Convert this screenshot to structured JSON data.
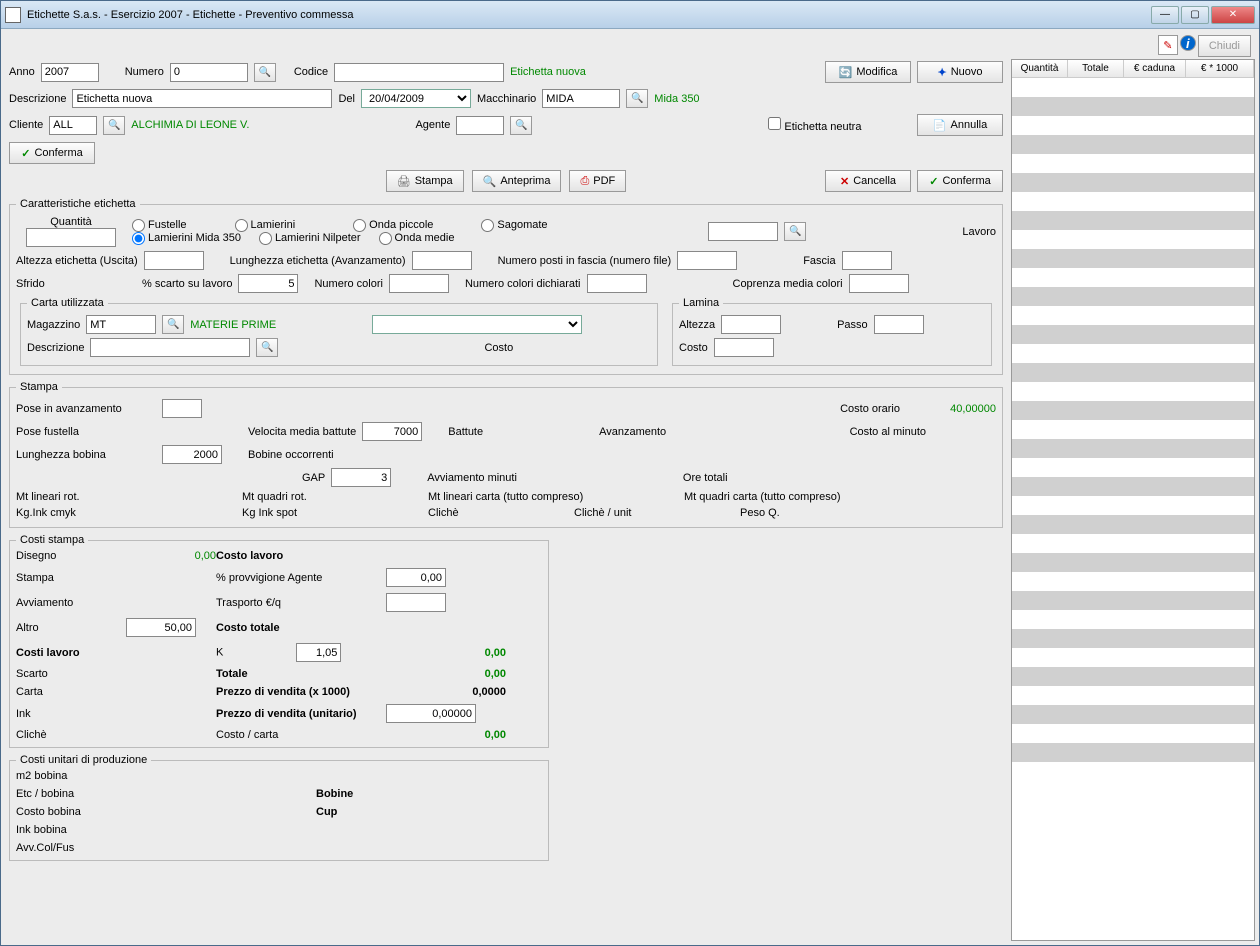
{
  "window": {
    "title": "Etichette S.a.s. - Esercizio 2007 - Etichette - Preventivo commessa"
  },
  "toolbar": {
    "chiudi": "Chiudi",
    "modifica": "Modifica",
    "nuovo": "Nuovo",
    "annulla": "Annulla",
    "conferma": "Conferma",
    "cancella": "Cancella",
    "stampa": "Stampa",
    "anteprima": "Anteprima",
    "pdf": "PDF"
  },
  "head": {
    "anno_lbl": "Anno",
    "anno": "2007",
    "numero_lbl": "Numero",
    "numero": "0",
    "codice_lbl": "Codice",
    "codice": "",
    "etichetta_nuova": "Etichetta nuova",
    "descrizione_lbl": "Descrizione",
    "descrizione": "Etichetta nuova",
    "del_lbl": "Del",
    "del": "20/04/2009",
    "macchinario_lbl": "Macchinario",
    "macchinario": "MIDA",
    "macchinario_desc": "Mida 350",
    "cliente_lbl": "Cliente",
    "cliente": "ALL",
    "cliente_desc": "ALCHIMIA DI LEONE V.",
    "agente_lbl": "Agente",
    "agente": "",
    "etichetta_neutra_lbl": "Etichetta neutra"
  },
  "grid": {
    "h1": "Quantità",
    "h2": "Totale",
    "h3": "€ caduna",
    "h4": "€ * 1000"
  },
  "caratt": {
    "legend": "Caratteristiche etichetta",
    "quantita_lbl": "Quantità",
    "quantita": "",
    "r_fustelle": "Fustelle",
    "r_lamierini": "Lamierini",
    "r_onda_piccole": "Onda piccole",
    "r_sagomate": "Sagomate",
    "r_lamierini_mida": "Lamierini Mida 350",
    "r_lamierini_nilpeter": "Lamierini Nilpeter",
    "r_onda_medie": "Onda medie",
    "lavoro_lbl": "Lavoro",
    "lavoro": "",
    "altezza_lbl": "Altezza etichetta (Uscita)",
    "altezza": "",
    "lunghezza_lbl": "Lunghezza etichetta (Avanzamento)",
    "lunghezza": "",
    "posti_lbl": "Numero posti in fascia (numero file)",
    "posti": "",
    "fascia_lbl": "Fascia",
    "fascia": "",
    "sfrido_lbl": "Sfrido",
    "scarto_lbl": "% scarto su lavoro",
    "scarto": "5",
    "ncolori_lbl": "Numero colori",
    "ncolori": "",
    "ncolori_dich_lbl": "Numero colori dichiarati",
    "ncolori_dich": "",
    "coprenza_lbl": "Coprenza media colori",
    "coprenza": ""
  },
  "carta": {
    "legend": "Carta utilizzata",
    "magazzino_lbl": "Magazzino",
    "magazzino": "MT",
    "magazzino_desc": "MATERIE PRIME",
    "combo": "",
    "descrizione_lbl": "Descrizione",
    "descrizione": "",
    "costo_lbl": "Costo"
  },
  "lamina": {
    "legend": "Lamina",
    "altezza_lbl": "Altezza",
    "altezza": "",
    "passo_lbl": "Passo",
    "passo": "",
    "costo_lbl": "Costo",
    "costo": ""
  },
  "stampa": {
    "legend": "Stampa",
    "pose_avz_lbl": "Pose in avanzamento",
    "pose_avz": "",
    "costo_orario_lbl": "Costo orario",
    "costo_orario": "40,00000",
    "pose_fust_lbl": "Pose fustella",
    "pose_fust": "",
    "vel_lbl": "Velocita media battute",
    "vel": "7000",
    "battute_lbl": "Battute",
    "avanzamento_lbl": "Avanzamento",
    "costo_min_lbl": "Costo al minuto",
    "lungh_bob_lbl": "Lunghezza bobina",
    "lungh_bob": "2000",
    "bobine_occ_lbl": "Bobine occorrenti",
    "gap_lbl": "GAP",
    "gap": "3",
    "avv_min_lbl": "Avviamento minuti",
    "ore_tot_lbl": "Ore totali",
    "mt_lin_rot_lbl": "Mt lineari rot.",
    "mt_quad_rot_lbl": "Mt quadri rot.",
    "mt_lin_carta_lbl": "Mt lineari carta (tutto compreso)",
    "mt_quad_carta_lbl": "Mt quadri carta (tutto compreso)",
    "kg_ink_cmyk_lbl": "Kg.Ink cmyk",
    "kg_ink_spot_lbl": "Kg Ink spot",
    "cliche_lbl": "Clichè",
    "cliche_unit_lbl": "Clichè / unit",
    "peso_q_lbl": "Peso Q."
  },
  "costi": {
    "legend": "Costi stampa",
    "disegno_lbl": "Disegno",
    "disegno": "0,00",
    "stampa_lbl": "Stampa",
    "avviamento_lbl": "Avviamento",
    "altro_lbl": "Altro",
    "altro": "50,00",
    "costi_lavoro_lbl": "Costi lavoro",
    "scarto_lbl": "Scarto",
    "carta_lbl": "Carta",
    "ink_lbl": "Ink",
    "cliche_lbl": "Clichè",
    "costo_lavoro_lbl": "Costo lavoro",
    "provv_lbl": "%  provvigione Agente",
    "provv": "0,00",
    "trasporto_lbl": "Trasporto €/q",
    "trasporto": "",
    "costo_tot_lbl": "Costo totale",
    "k_lbl": "K",
    "k": "1,05",
    "k_val": "0,00",
    "totale_lbl": "Totale",
    "totale": "0,00",
    "prezzo_x1000_lbl": "Prezzo di vendita (x 1000)",
    "prezzo_x1000": "0,0000",
    "prezzo_unit_lbl": "Prezzo di vendita (unitario)",
    "prezzo_unit": "0,00000",
    "costo_carta_lbl": "Costo / carta",
    "costo_carta": "0,00"
  },
  "unit": {
    "legend": "Costi unitari di produzione",
    "m2_bob_lbl": "m2 bobina",
    "etc_bob_lbl": "Etc / bobina",
    "bobine_lbl": "Bobine",
    "costo_bob_lbl": "Costo bobina",
    "cup_lbl": "Cup",
    "ink_bob_lbl": "Ink bobina",
    "avv_col_lbl": "Avv.Col/Fus"
  }
}
